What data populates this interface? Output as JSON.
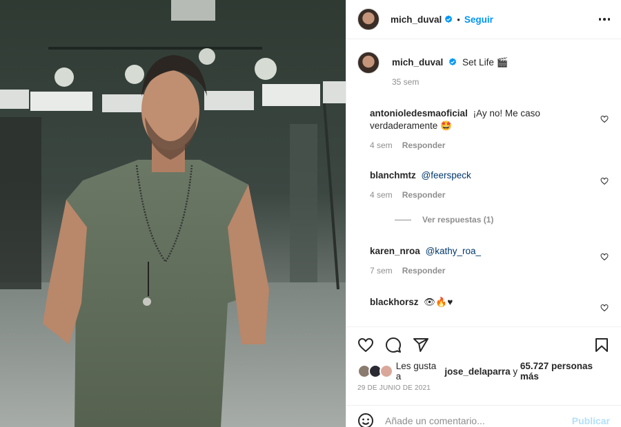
{
  "colors": {
    "accent": "#0095f6",
    "text": "#262626",
    "muted": "#8e8e8e",
    "mention": "#00376b",
    "publish_disabled": "#b2dffc"
  },
  "photo": {
    "alt_icon": "post-photo"
  },
  "header": {
    "username": "mich_duval",
    "dot": "•",
    "follow_label": "Seguir"
  },
  "caption": {
    "username": "mich_duval",
    "text": "Set Life 🎬",
    "time": "35 sem"
  },
  "comments": [
    {
      "username": "antonioledesmaoficial",
      "text": "¡Ay no! Me caso verdaderamente 🤩",
      "time": "4 sem",
      "reply": "Responder"
    },
    {
      "username": "blanchmtz",
      "mention": "@feerspeck",
      "time": "4 sem",
      "reply": "Responder"
    },
    {
      "username": "karen_nroa",
      "mention": "@kathy_roa_",
      "time": "7 sem",
      "reply": "Responder"
    },
    {
      "username": "blackhorsz",
      "text": "👁🔥♥"
    }
  ],
  "view_replies": "Ver respuestas (1)",
  "likes": {
    "prefix": "Les gusta a",
    "user": "jose_delaparra",
    "connector": "y",
    "count": "65.727 personas más"
  },
  "date": "29 DE JUNIO DE 2021",
  "add_comment": {
    "placeholder": "Añade un comentario...",
    "publish_label": "Publicar"
  }
}
